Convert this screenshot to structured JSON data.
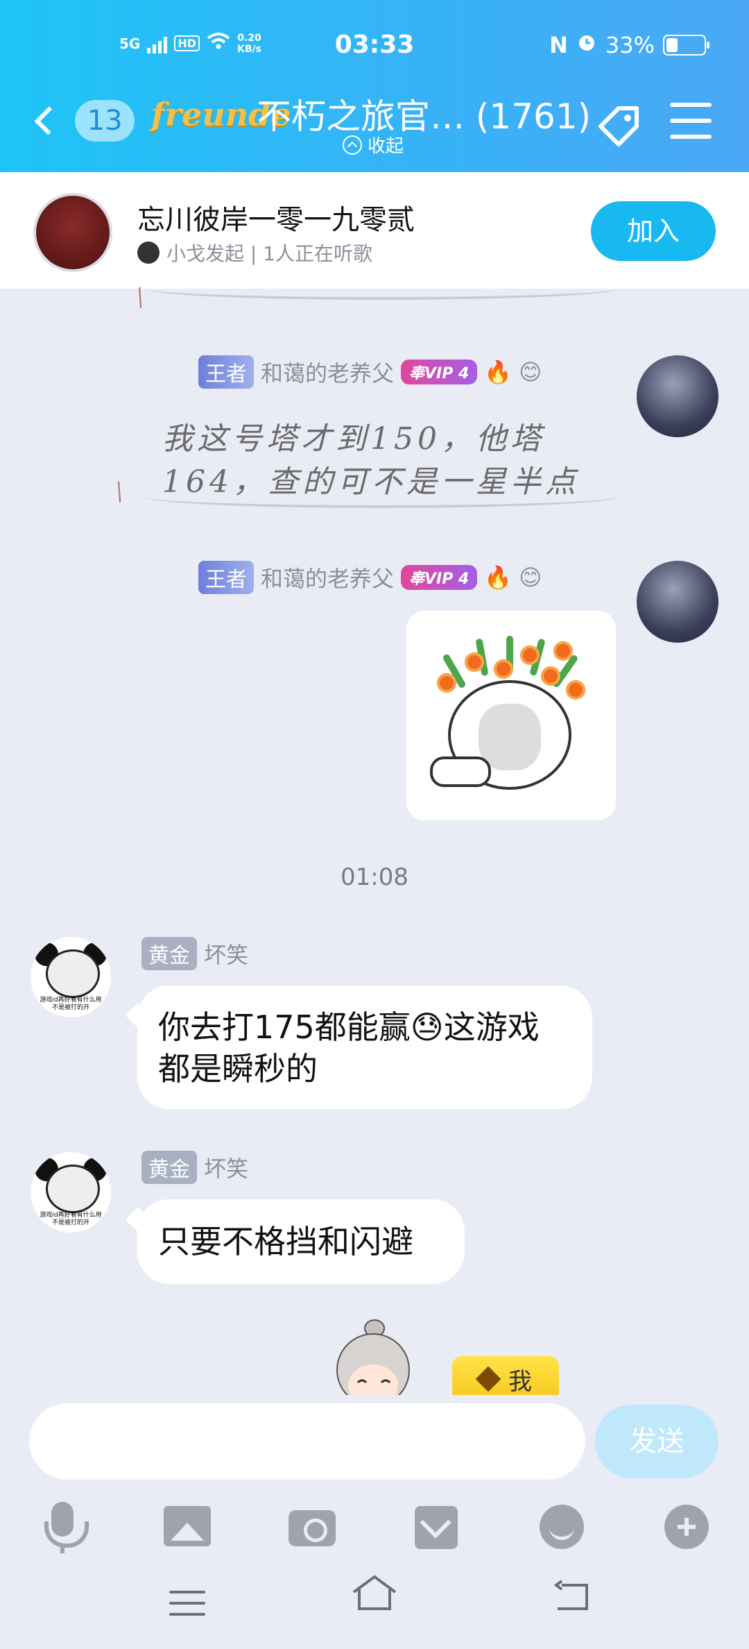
{
  "status_bar": {
    "network": "5G",
    "hd": "HD",
    "speed_value": "0.20",
    "speed_unit": "KB/s",
    "time": "03:33",
    "battery": "33%",
    "battery_level": 0.33
  },
  "header": {
    "back_count": "13",
    "brand_logo": "freunde",
    "group_title": "不朽之旅官… (1761)",
    "collapse_label": "收起"
  },
  "listen_bar": {
    "title": "忘川彼岸一零一九零贰",
    "subtitle": "小戈发起 | 1人正在听歌",
    "join_label": "加入"
  },
  "messages": {
    "m1": {
      "rank": "王者",
      "sender": "和蔼的老养父",
      "vip": "奉VIP 4",
      "text_line1": "我这号塔才到150，他塔",
      "text_line2": "164，查的可不是一星半点"
    },
    "m2": {
      "rank": "王者",
      "sender": "和蔼的老养父",
      "vip": "奉VIP 4"
    },
    "time_separator": "01:08",
    "m3": {
      "rank": "黄金",
      "sender": "坏笑",
      "text_line1": "你去打175都能赢😓这游戏",
      "text_line2": "都是瞬秒的",
      "avatar_caption": "游戏id再好看有什么用 不是被打的开"
    },
    "m4": {
      "rank": "黄金",
      "sender": "坏笑",
      "text": "只要不格挡和闪避",
      "avatar_caption": "游戏id再好看有什么用 不是被打的开"
    },
    "me_tag": "我"
  },
  "input": {
    "placeholder": "",
    "send_label": "发送"
  },
  "colors": {
    "header_gradient_start": "#1ec4f6",
    "header_gradient_end": "#4aa8f5",
    "join_button": "#18b8f0",
    "send_button_disabled": "#bfe8fb",
    "background": "#e9ecf5"
  }
}
